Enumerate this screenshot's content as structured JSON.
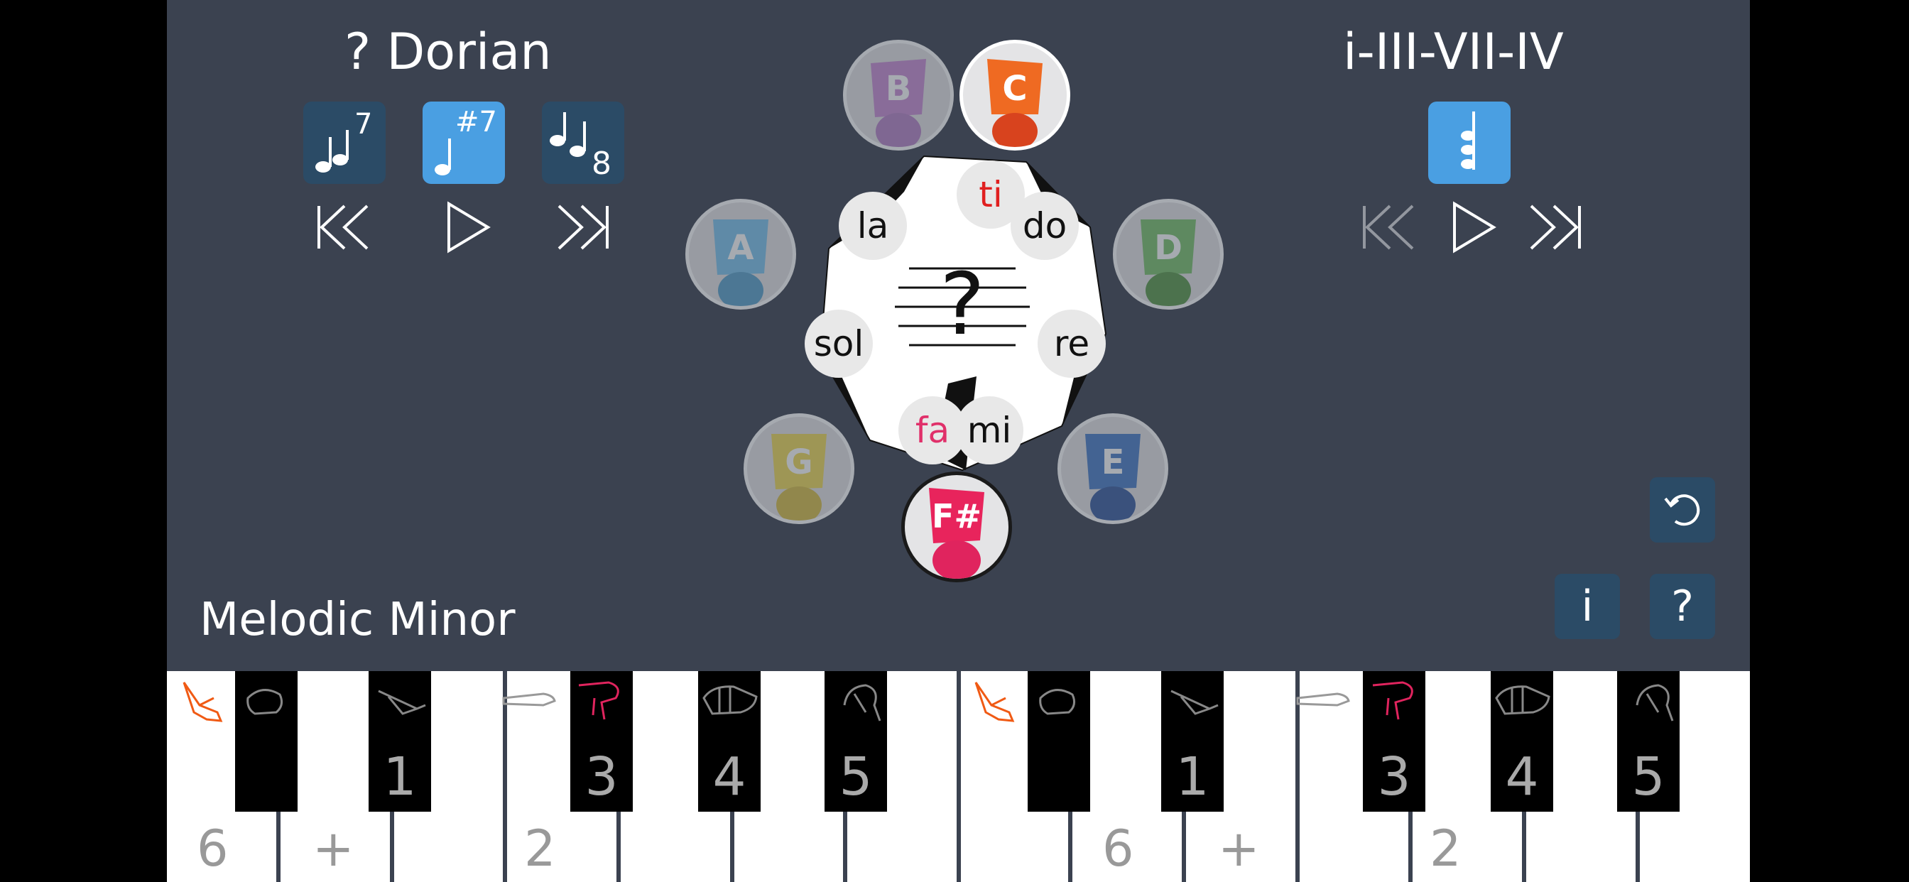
{
  "left_panel": {
    "mode_title": "? Dorian",
    "buttons": [
      {
        "name": "natural-seventh",
        "superscript": "7",
        "active": false
      },
      {
        "name": "sharp-seventh",
        "superscript": "#7",
        "active": true
      },
      {
        "name": "octave",
        "superscript": "8",
        "active": false
      }
    ]
  },
  "right_panel": {
    "progression_title": "i-III-VII-IV",
    "rhythm_button_active": true
  },
  "scale_label": "Melodic Minor",
  "center": {
    "question_mark": "?"
  },
  "note_heads": [
    {
      "letter": "B",
      "color": "#c98fd6",
      "dim": true
    },
    {
      "letter": "C",
      "color": "#ef6a22",
      "dim": false
    },
    {
      "letter": "D",
      "color": "#7cc46e",
      "dim": true
    },
    {
      "letter": "E",
      "color": "#4a7fc9",
      "dim": true
    },
    {
      "letter": "F#",
      "color": "#e8245c",
      "dim": false
    },
    {
      "letter": "G",
      "color": "#f0dc5a",
      "dim": true
    },
    {
      "letter": "A",
      "color": "#7ec6ee",
      "dim": true
    }
  ],
  "solfege": [
    "ti",
    "do",
    "re",
    "mi",
    "fa",
    "sol",
    "la"
  ],
  "side_buttons": {
    "info": "i",
    "help": "?"
  },
  "keyboard": {
    "white_labels": [
      "6",
      "+",
      "",
      "2",
      "",
      "",
      "",
      "",
      "6",
      "+",
      "",
      "2",
      "",
      "",
      ""
    ],
    "black_labels": [
      "",
      "1",
      "3",
      "4",
      "5",
      "",
      "1",
      "3",
      "4",
      "5"
    ],
    "colors": {
      "orange": "#f05a14",
      "pink": "#e0245e",
      "gray": "#888888"
    }
  }
}
